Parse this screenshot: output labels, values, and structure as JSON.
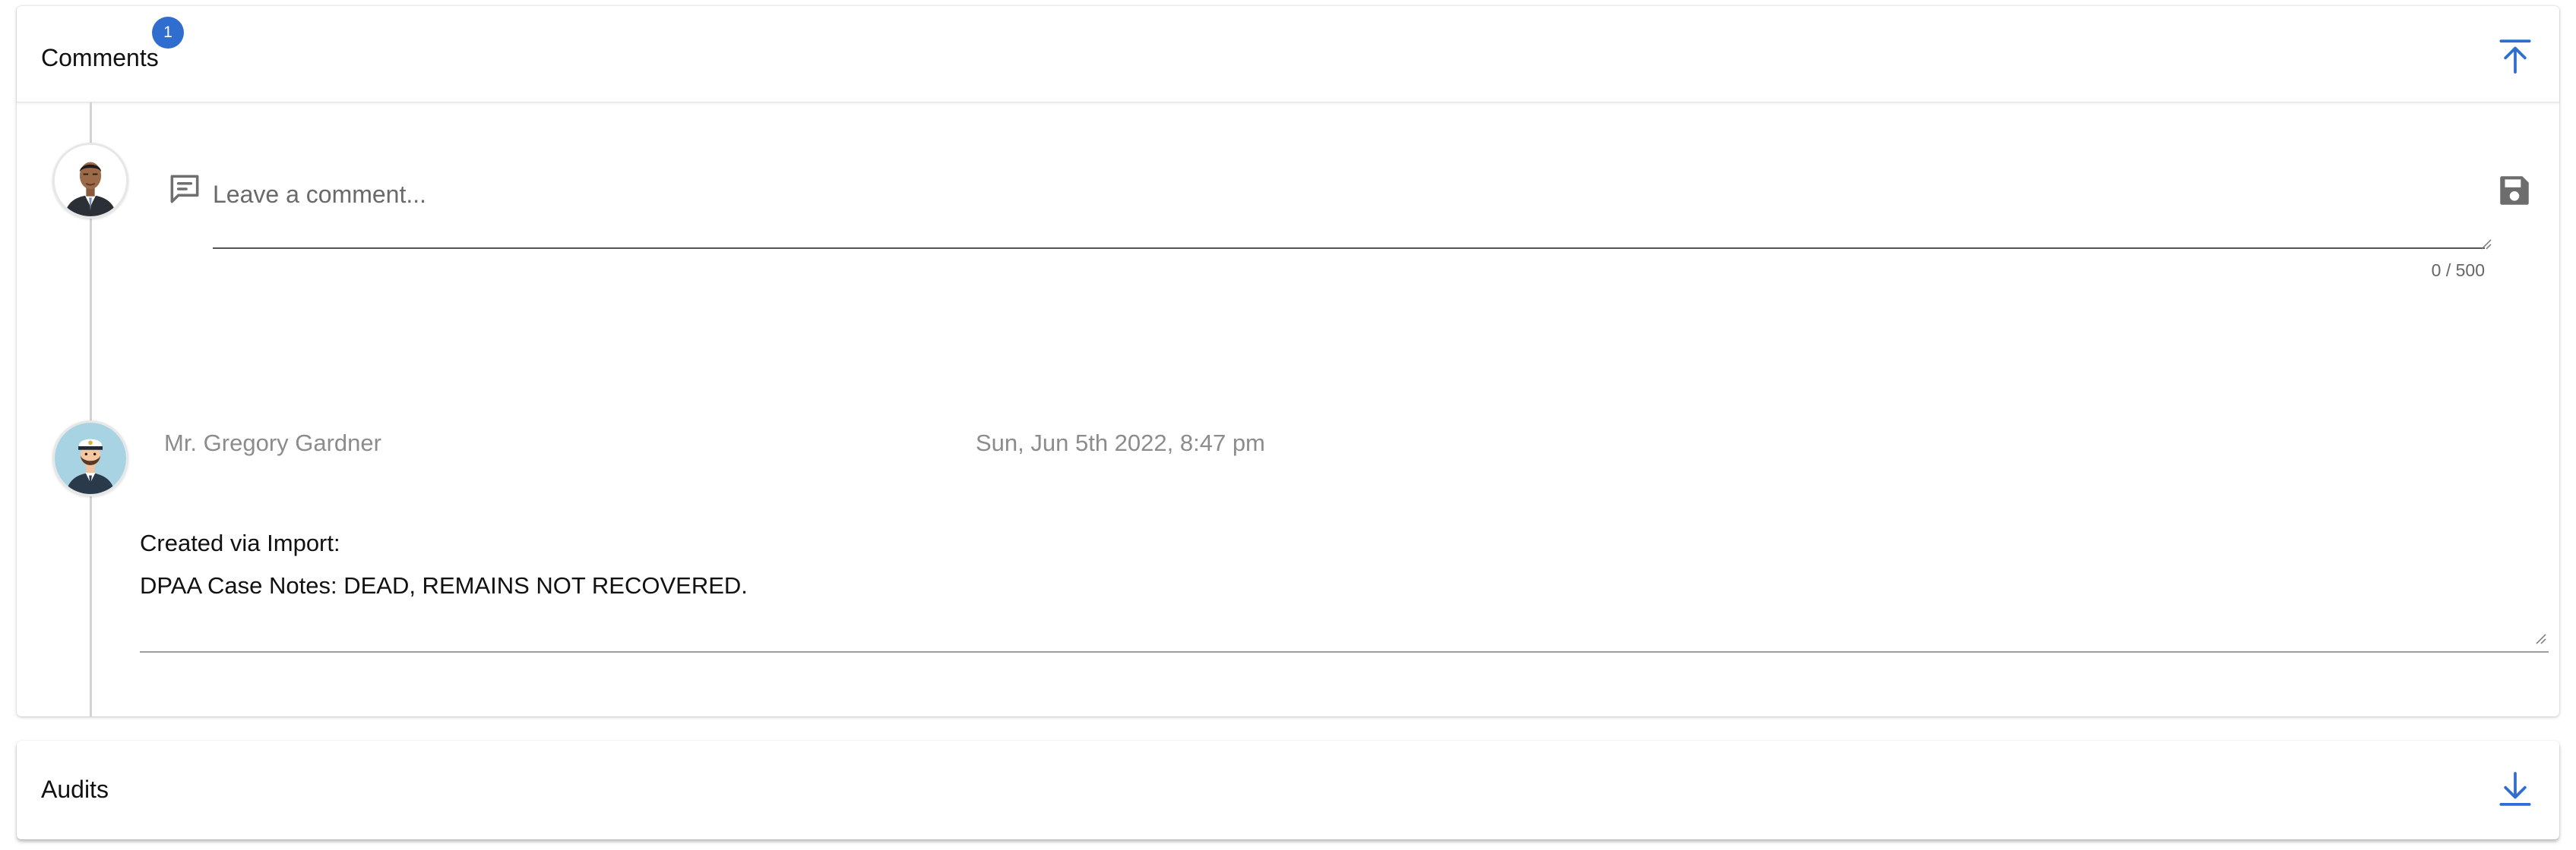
{
  "comments": {
    "title": "Comments",
    "badge_count": "1",
    "input": {
      "placeholder": "Leave a comment...",
      "value": "",
      "counter": "0 / 500"
    },
    "items": [
      {
        "author": "Mr. Gregory Gardner",
        "date": "Sun, Jun 5th 2022, 8:47 pm",
        "lines": [
          "Created via Import:",
          "DPAA Case Notes: DEAD, REMAINS NOT RECOVERED."
        ]
      }
    ],
    "icons": {
      "collapse": "arrow-up-to-line-icon",
      "comment": "comment-text-outline-icon",
      "save": "floppy-disk-icon"
    }
  },
  "audits": {
    "title": "Audits",
    "icons": {
      "expand": "arrow-down-to-line-icon"
    }
  },
  "colors": {
    "accent": "#2f6ecf",
    "muted_text": "#8c8c8c",
    "timeline": "#d4d4d4"
  }
}
